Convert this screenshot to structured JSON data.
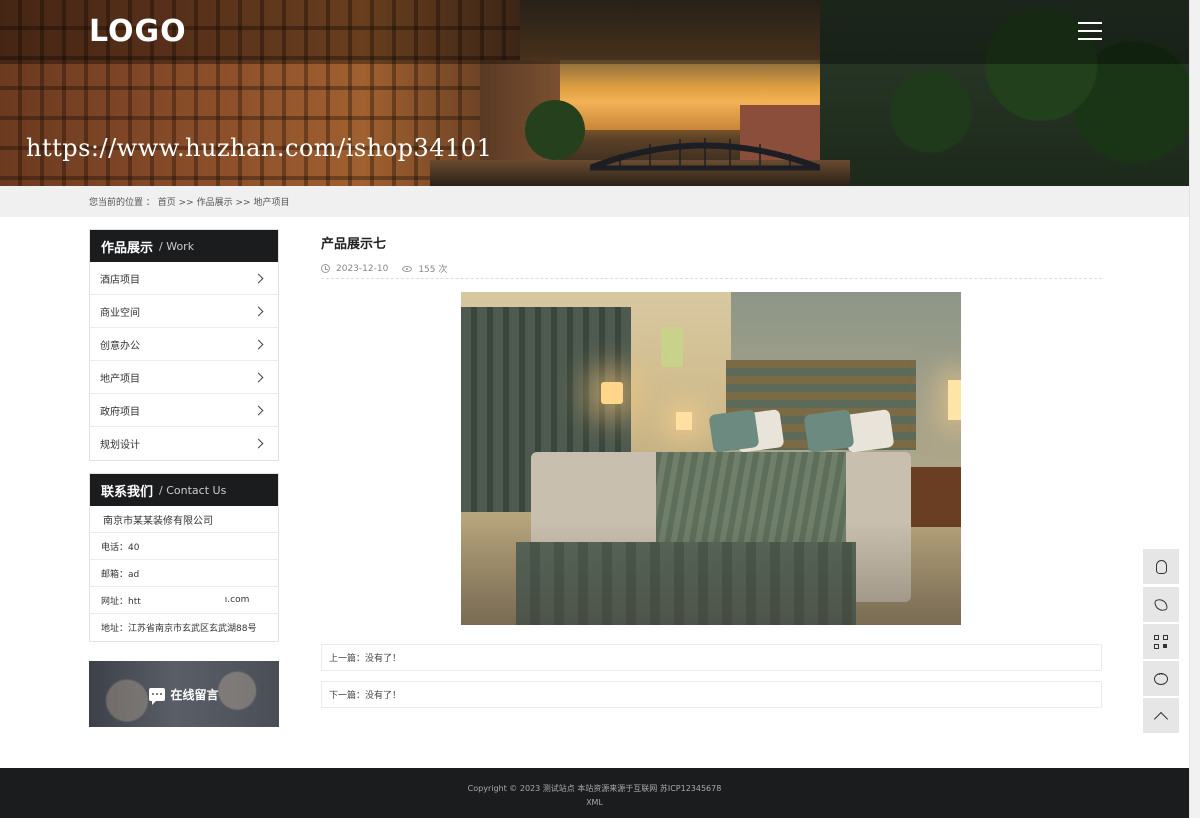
{
  "header": {
    "logo_text": "LOGO",
    "watermark_url": "https://www.huzhan.com/ishop34101"
  },
  "breadcrumb": {
    "label": "您当前的位置 ：",
    "items": [
      "首页",
      "作品展示",
      "地产项目"
    ],
    "separator": ">>"
  },
  "sidebar": {
    "works": {
      "title": "作品展示",
      "subtitle": "/ Work",
      "items": [
        {
          "label": "酒店项目"
        },
        {
          "label": "商业空间"
        },
        {
          "label": "创意办公"
        },
        {
          "label": "地产项目"
        },
        {
          "label": "政府项目"
        },
        {
          "label": "规划设计"
        }
      ]
    },
    "contact": {
      "title": "联系我们",
      "subtitle": "/ Contact Us",
      "company": "南京市某某装修有限公司",
      "phone": "电话：40",
      "email": "邮箱：ad",
      "website_prefix": "网址：htt",
      "website_suffix": "ı.com",
      "address": "地址：江苏省南京市玄武区玄武湖88号"
    },
    "message_button": "在线留言"
  },
  "article": {
    "title": "产品展示七",
    "date": "2023-12-10",
    "views": "155 次",
    "prev": "上一篇：没有了！",
    "next": "下一篇：没有了！"
  },
  "float_tools": [
    {
      "icon": "qq-icon"
    },
    {
      "icon": "phone-icon"
    },
    {
      "icon": "qrcode-icon"
    },
    {
      "icon": "chat-icon"
    },
    {
      "icon": "back-to-top-icon"
    }
  ],
  "footer": {
    "copyright": "Copyright © 2023 测试站点 本站资源来源于互联网 苏ICP12345678",
    "xml": "XML"
  },
  "colors": {
    "dark": "#1b1c1e",
    "crumb_bg": "#f0f0f0",
    "tool_bg": "#e6e6e6"
  }
}
